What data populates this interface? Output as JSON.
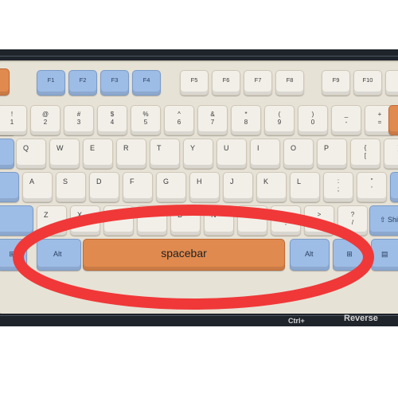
{
  "function_row": [
    "F1",
    "F2",
    "F3",
    "F4",
    "F5",
    "F6",
    "F7",
    "F8",
    "F9",
    "F10"
  ],
  "number_row": [
    {
      "top": "!",
      "bottom": "1"
    },
    {
      "top": "@",
      "bottom": "2"
    },
    {
      "top": "#",
      "bottom": "3"
    },
    {
      "top": "$",
      "bottom": "4"
    },
    {
      "top": "%",
      "bottom": "5"
    },
    {
      "top": "^",
      "bottom": "6"
    },
    {
      "top": "&",
      "bottom": "7"
    },
    {
      "top": "*",
      "bottom": "8"
    },
    {
      "top": "(",
      "bottom": "9"
    },
    {
      "top": ")",
      "bottom": "0"
    },
    {
      "top": "_",
      "bottom": "-"
    },
    {
      "top": "+",
      "bottom": "="
    }
  ],
  "qwerty_row": [
    "Q",
    "W",
    "E",
    "R",
    "T",
    "Y",
    "U",
    "I",
    "O",
    "P"
  ],
  "qwerty_extra": [
    {
      "top": "{",
      "bottom": "["
    },
    {
      "top": "}",
      "bottom": "]"
    }
  ],
  "home_row": [
    "A",
    "S",
    "D",
    "F",
    "G",
    "H",
    "J",
    "K",
    "L"
  ],
  "home_extra": [
    {
      "top": ":",
      "bottom": ";"
    },
    {
      "top": "\"",
      "bottom": "'"
    }
  ],
  "bottom_letter_row": [
    "Z",
    "X",
    "C",
    "V",
    "B",
    "N",
    "M"
  ],
  "bottom_extra": [
    {
      "top": "<",
      "bottom": ","
    },
    {
      "top": ">",
      "bottom": "."
    },
    {
      "top": "?",
      "bottom": "/"
    }
  ],
  "shift_right_label": "Shift",
  "alt_left": "Alt",
  "alt_right": "Alt",
  "spacebar_label": "spacebar",
  "mat_text": {
    "bottom_right": "Reverse",
    "bottom_ctrl": "Ctrl+"
  },
  "colors": {
    "highlight": "#f03838",
    "accent_orange": "#e08a4f",
    "accent_blue": "#9dbce6"
  }
}
